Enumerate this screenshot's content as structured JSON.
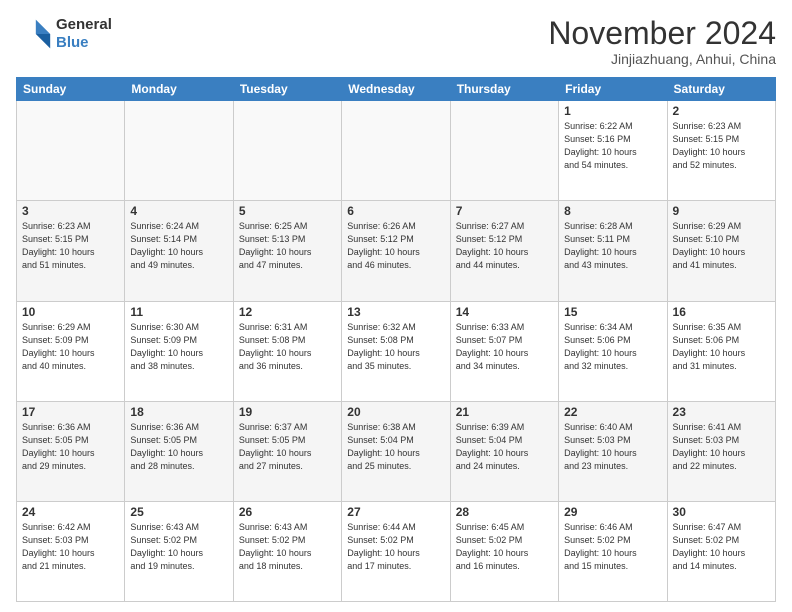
{
  "header": {
    "logo_line1": "General",
    "logo_line2": "Blue",
    "month_title": "November 2024",
    "location": "Jinjiazhuang, Anhui, China"
  },
  "weekdays": [
    "Sunday",
    "Monday",
    "Tuesday",
    "Wednesday",
    "Thursday",
    "Friday",
    "Saturday"
  ],
  "weeks": [
    [
      {
        "day": "",
        "info": ""
      },
      {
        "day": "",
        "info": ""
      },
      {
        "day": "",
        "info": ""
      },
      {
        "day": "",
        "info": ""
      },
      {
        "day": "",
        "info": ""
      },
      {
        "day": "1",
        "info": "Sunrise: 6:22 AM\nSunset: 5:16 PM\nDaylight: 10 hours\nand 54 minutes."
      },
      {
        "day": "2",
        "info": "Sunrise: 6:23 AM\nSunset: 5:15 PM\nDaylight: 10 hours\nand 52 minutes."
      }
    ],
    [
      {
        "day": "3",
        "info": "Sunrise: 6:23 AM\nSunset: 5:15 PM\nDaylight: 10 hours\nand 51 minutes."
      },
      {
        "day": "4",
        "info": "Sunrise: 6:24 AM\nSunset: 5:14 PM\nDaylight: 10 hours\nand 49 minutes."
      },
      {
        "day": "5",
        "info": "Sunrise: 6:25 AM\nSunset: 5:13 PM\nDaylight: 10 hours\nand 47 minutes."
      },
      {
        "day": "6",
        "info": "Sunrise: 6:26 AM\nSunset: 5:12 PM\nDaylight: 10 hours\nand 46 minutes."
      },
      {
        "day": "7",
        "info": "Sunrise: 6:27 AM\nSunset: 5:12 PM\nDaylight: 10 hours\nand 44 minutes."
      },
      {
        "day": "8",
        "info": "Sunrise: 6:28 AM\nSunset: 5:11 PM\nDaylight: 10 hours\nand 43 minutes."
      },
      {
        "day": "9",
        "info": "Sunrise: 6:29 AM\nSunset: 5:10 PM\nDaylight: 10 hours\nand 41 minutes."
      }
    ],
    [
      {
        "day": "10",
        "info": "Sunrise: 6:29 AM\nSunset: 5:09 PM\nDaylight: 10 hours\nand 40 minutes."
      },
      {
        "day": "11",
        "info": "Sunrise: 6:30 AM\nSunset: 5:09 PM\nDaylight: 10 hours\nand 38 minutes."
      },
      {
        "day": "12",
        "info": "Sunrise: 6:31 AM\nSunset: 5:08 PM\nDaylight: 10 hours\nand 36 minutes."
      },
      {
        "day": "13",
        "info": "Sunrise: 6:32 AM\nSunset: 5:08 PM\nDaylight: 10 hours\nand 35 minutes."
      },
      {
        "day": "14",
        "info": "Sunrise: 6:33 AM\nSunset: 5:07 PM\nDaylight: 10 hours\nand 34 minutes."
      },
      {
        "day": "15",
        "info": "Sunrise: 6:34 AM\nSunset: 5:06 PM\nDaylight: 10 hours\nand 32 minutes."
      },
      {
        "day": "16",
        "info": "Sunrise: 6:35 AM\nSunset: 5:06 PM\nDaylight: 10 hours\nand 31 minutes."
      }
    ],
    [
      {
        "day": "17",
        "info": "Sunrise: 6:36 AM\nSunset: 5:05 PM\nDaylight: 10 hours\nand 29 minutes."
      },
      {
        "day": "18",
        "info": "Sunrise: 6:36 AM\nSunset: 5:05 PM\nDaylight: 10 hours\nand 28 minutes."
      },
      {
        "day": "19",
        "info": "Sunrise: 6:37 AM\nSunset: 5:05 PM\nDaylight: 10 hours\nand 27 minutes."
      },
      {
        "day": "20",
        "info": "Sunrise: 6:38 AM\nSunset: 5:04 PM\nDaylight: 10 hours\nand 25 minutes."
      },
      {
        "day": "21",
        "info": "Sunrise: 6:39 AM\nSunset: 5:04 PM\nDaylight: 10 hours\nand 24 minutes."
      },
      {
        "day": "22",
        "info": "Sunrise: 6:40 AM\nSunset: 5:03 PM\nDaylight: 10 hours\nand 23 minutes."
      },
      {
        "day": "23",
        "info": "Sunrise: 6:41 AM\nSunset: 5:03 PM\nDaylight: 10 hours\nand 22 minutes."
      }
    ],
    [
      {
        "day": "24",
        "info": "Sunrise: 6:42 AM\nSunset: 5:03 PM\nDaylight: 10 hours\nand 21 minutes."
      },
      {
        "day": "25",
        "info": "Sunrise: 6:43 AM\nSunset: 5:02 PM\nDaylight: 10 hours\nand 19 minutes."
      },
      {
        "day": "26",
        "info": "Sunrise: 6:43 AM\nSunset: 5:02 PM\nDaylight: 10 hours\nand 18 minutes."
      },
      {
        "day": "27",
        "info": "Sunrise: 6:44 AM\nSunset: 5:02 PM\nDaylight: 10 hours\nand 17 minutes."
      },
      {
        "day": "28",
        "info": "Sunrise: 6:45 AM\nSunset: 5:02 PM\nDaylight: 10 hours\nand 16 minutes."
      },
      {
        "day": "29",
        "info": "Sunrise: 6:46 AM\nSunset: 5:02 PM\nDaylight: 10 hours\nand 15 minutes."
      },
      {
        "day": "30",
        "info": "Sunrise: 6:47 AM\nSunset: 5:02 PM\nDaylight: 10 hours\nand 14 minutes."
      }
    ]
  ]
}
